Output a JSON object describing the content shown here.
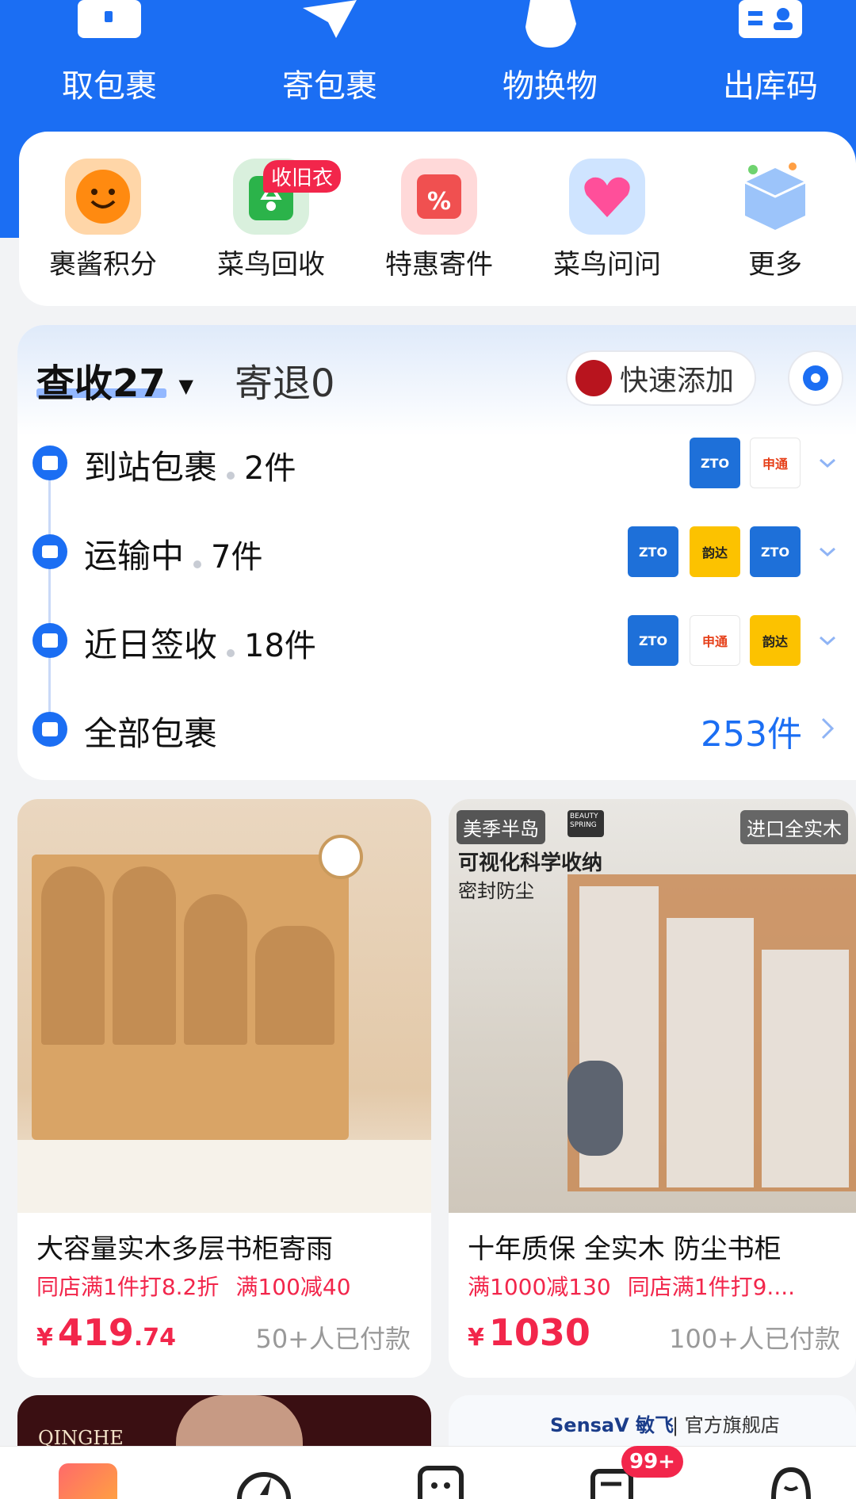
{
  "quick_actions": [
    {
      "label": "取包裹",
      "icon": "pickup-box-icon"
    },
    {
      "label": "寄包裹",
      "icon": "send-plane-icon"
    },
    {
      "label": "物换物",
      "icon": "hand-exchange-icon"
    },
    {
      "label": "出库码",
      "icon": "id-card-icon"
    }
  ],
  "services": [
    {
      "label": "裹酱积分",
      "icon": "smiley-points-icon",
      "badge": ""
    },
    {
      "label": "菜鸟回收",
      "icon": "recycle-icon",
      "badge": "收旧衣"
    },
    {
      "label": "特惠寄件",
      "icon": "discount-box-icon",
      "badge": ""
    },
    {
      "label": "菜鸟问问",
      "icon": "heart-chat-icon",
      "badge": ""
    },
    {
      "label": "更多",
      "icon": "more-box-icon",
      "badge": ""
    }
  ],
  "packages": {
    "tab_active": "查收27",
    "tab_other": "寄退0",
    "quick_add": "快速添加",
    "rows": [
      {
        "label": "到站包裹",
        "count": "2件",
        "logos": [
          "ZTO",
          "申通"
        ]
      },
      {
        "label": "运输中",
        "count": "7件",
        "logos": [
          "ZTO",
          "韵达",
          "ZTO"
        ]
      },
      {
        "label": "近日签收",
        "count": "18件",
        "logos": [
          "ZTO",
          "申通",
          "韵达"
        ]
      },
      {
        "label": "全部包裹",
        "total": "253件"
      }
    ]
  },
  "products": [
    {
      "title": "大容量实木多层书柜寄雨",
      "promo1": "同店满1件打8.2折",
      "promo2": "满100减40",
      "currency": "¥",
      "price_int": "419",
      "price_dec": ".74",
      "paid": "50+人已付款"
    },
    {
      "title": "十年质保 全实木 防尘书柜",
      "promo1": "满1000减130",
      "promo2": "同店满1件打9....",
      "currency": "¥",
      "price_int": "1030",
      "price_dec": "",
      "paid": "100+人已付款",
      "overlay_brand": "美季半岛",
      "overlay_tag": "进口全实木",
      "overlay_line1": "可视化科学收纳",
      "overlay_line2": "密封防尘",
      "overlay_logo": "BEAUTY SPRING"
    }
  ],
  "next_cards": [
    {
      "brand": "QINGHE"
    },
    {
      "brand": "SensaV 敏飞",
      "suffix": "| 官方旗舰店"
    }
  ],
  "bottom_nav": {
    "badge": "99+",
    "items": [
      "home-icon",
      "compass-icon",
      "robot-icon",
      "message-icon",
      "profile-icon"
    ]
  },
  "colors": {
    "primary": "#1b6ef3",
    "accent_red": "#f2264b"
  }
}
